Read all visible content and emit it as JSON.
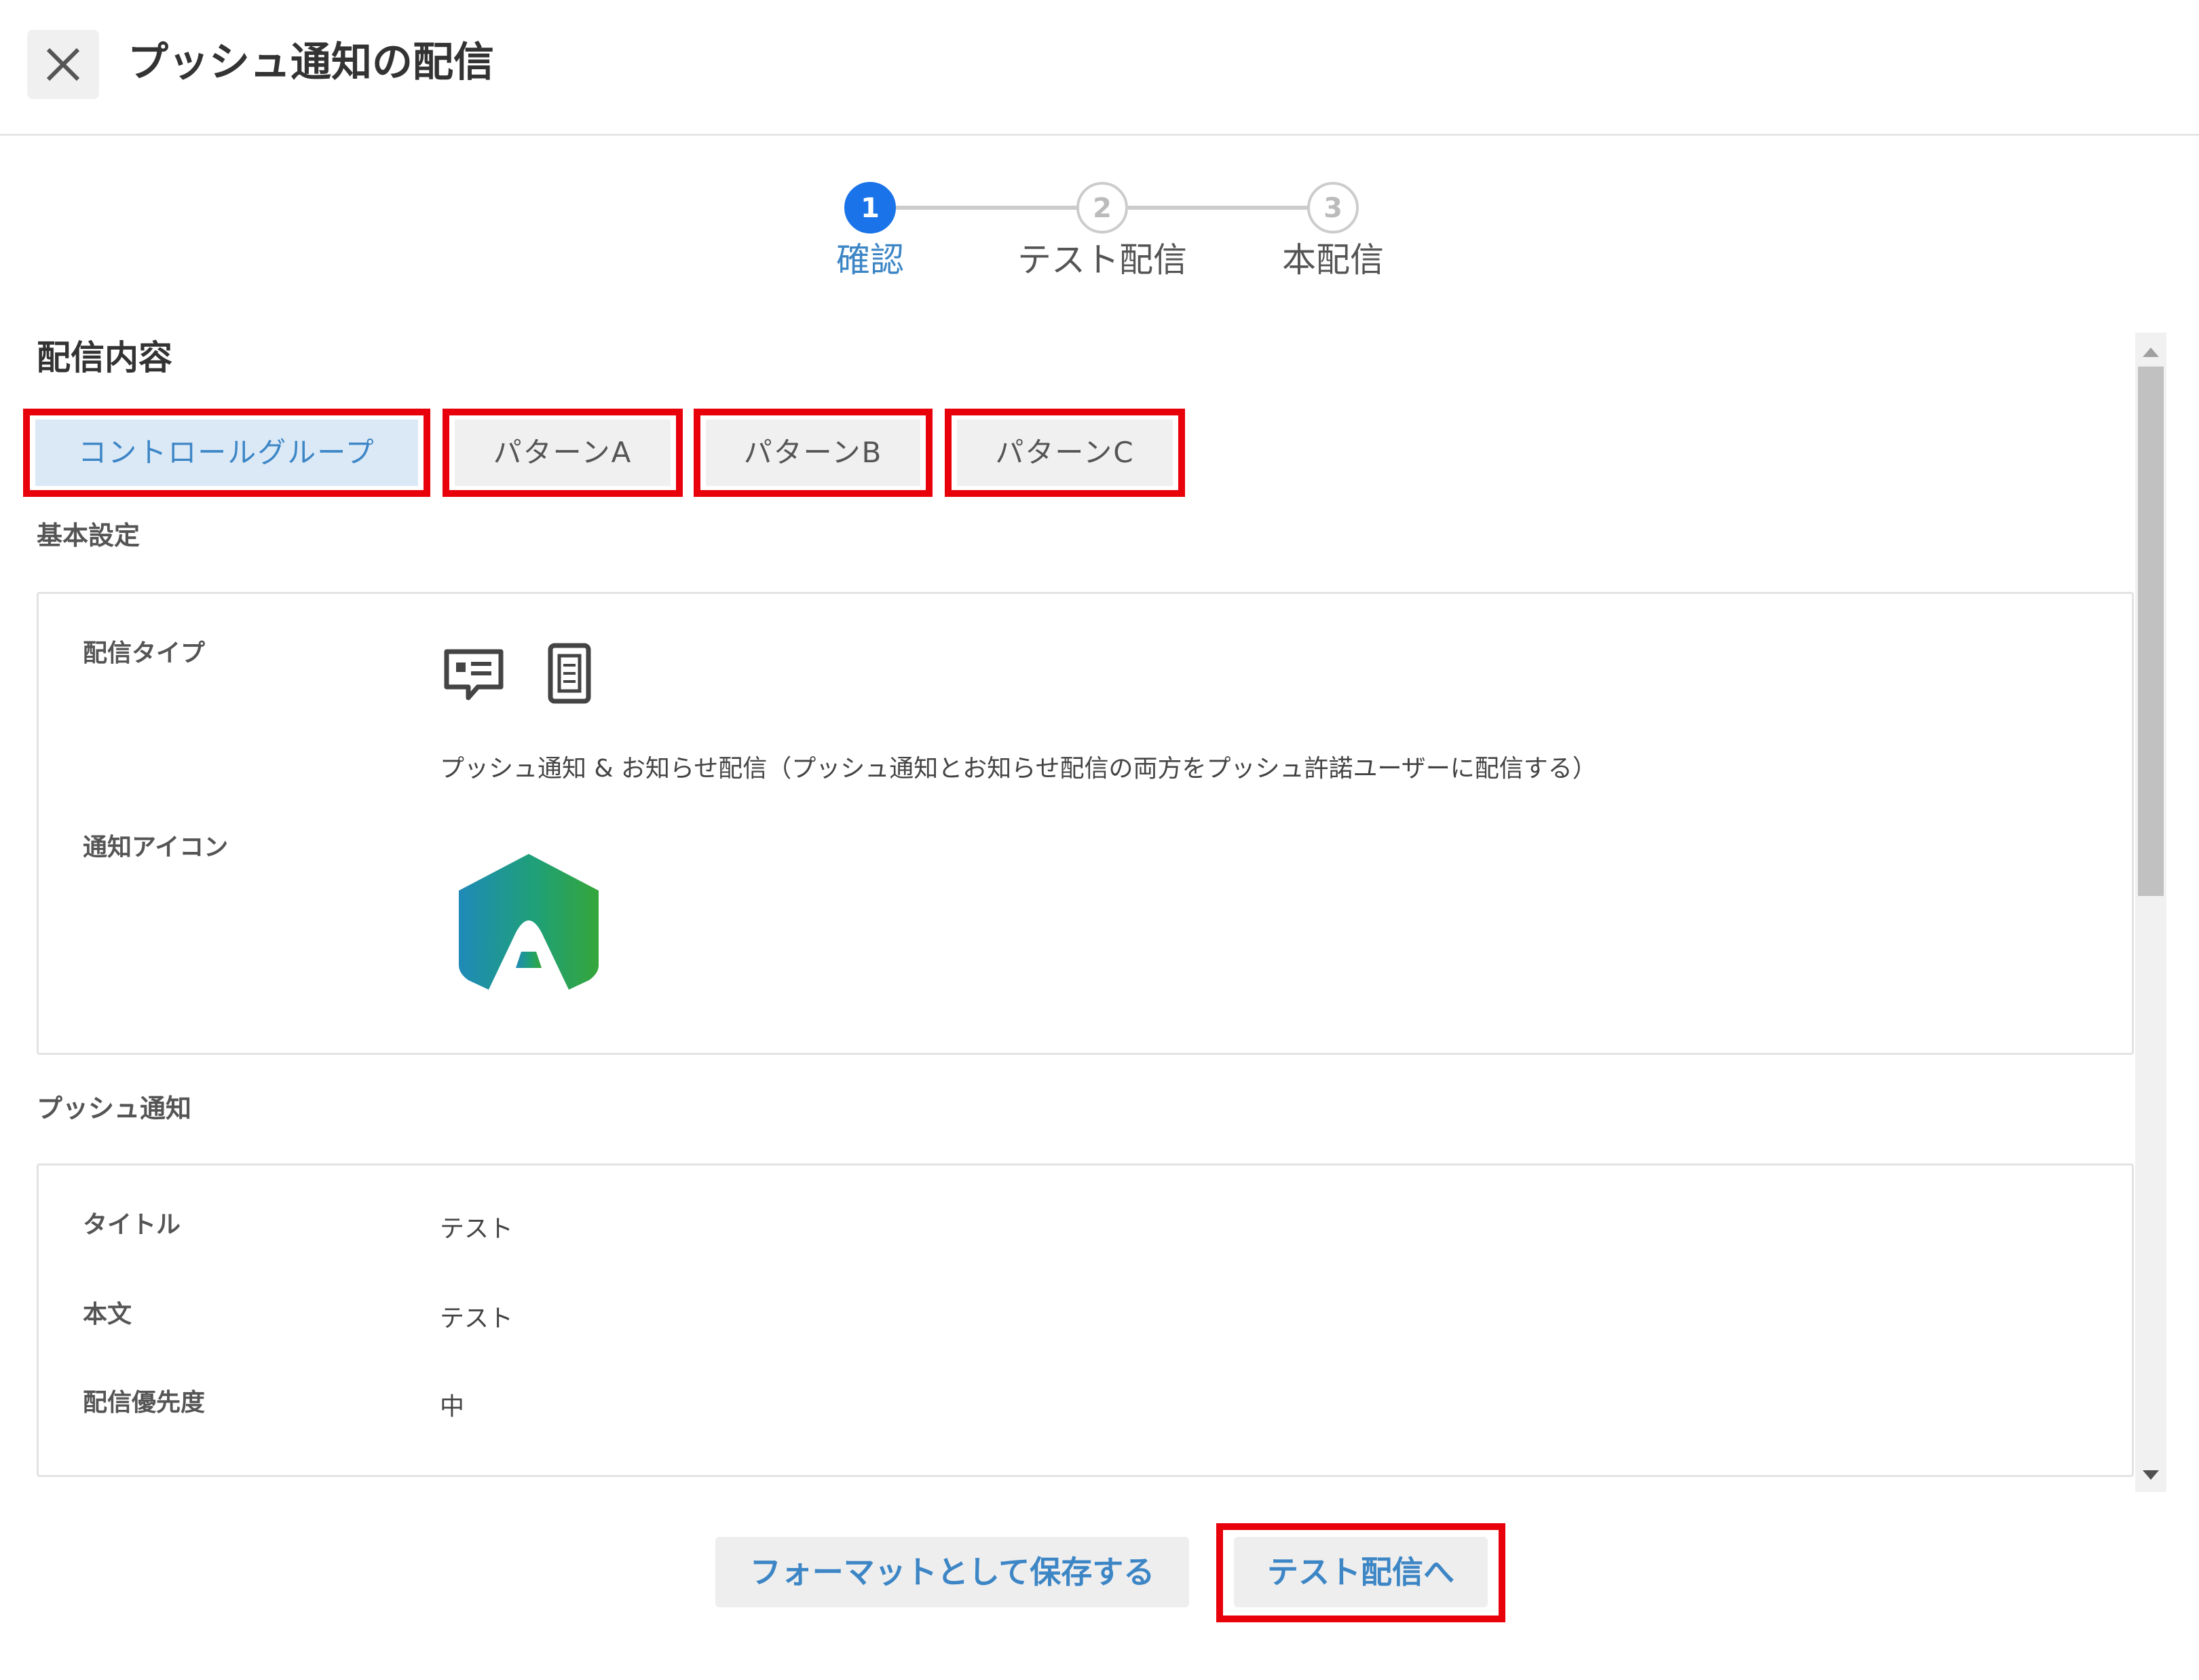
{
  "header": {
    "title": "プッシュ通知の配信",
    "close_icon": "close-icon"
  },
  "stepper": {
    "steps": [
      {
        "number": "1",
        "label": "確認",
        "state": "active"
      },
      {
        "number": "2",
        "label": "テスト配信",
        "state": "inactive"
      },
      {
        "number": "3",
        "label": "本配信",
        "state": "inactive"
      }
    ]
  },
  "content": {
    "section_title": "配信内容",
    "tabs": [
      {
        "label": "コントロールグループ",
        "selected": true
      },
      {
        "label": "パターンA",
        "selected": false
      },
      {
        "label": "パターンB",
        "selected": false
      },
      {
        "label": "パターンC",
        "selected": false
      }
    ],
    "basic_settings": {
      "title": "基本設定",
      "delivery_type_label": "配信タイプ",
      "delivery_type_icons": [
        "message-icon",
        "mobile-notice-icon"
      ],
      "delivery_type_desc": "プッシュ通知 & お知らせ配信（プッシュ通知とお知らせ配信の両方をプッシュ許諾ユーザーに配信する）",
      "notification_icon_label": "通知アイコン",
      "notification_icon": "app-logo-icon"
    },
    "push": {
      "title": "プッシュ通知",
      "rows": [
        {
          "label": "タイトル",
          "value": "テスト"
        },
        {
          "label": "本文",
          "value": "テスト"
        },
        {
          "label": "配信優先度",
          "value": "中"
        }
      ]
    }
  },
  "footer": {
    "save_format_label": "フォーマットとして保存する",
    "next_label": "テスト配信へ"
  },
  "colors": {
    "accent": "#1a73e8",
    "link": "#3d86c6",
    "highlight": "#e8000b",
    "tab_selected_bg": "#dbe9f7"
  }
}
